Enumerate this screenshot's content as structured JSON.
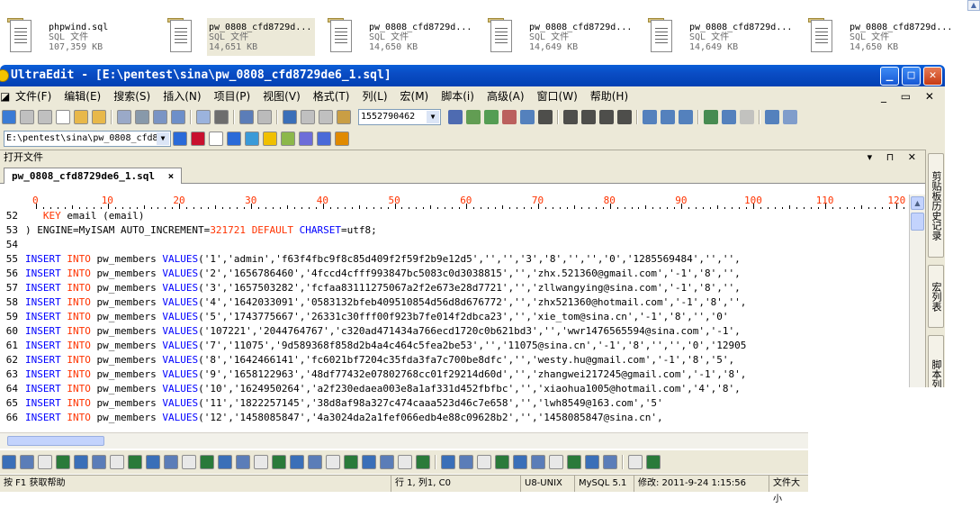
{
  "explorer": {
    "files": [
      {
        "name": "phpwind.sql",
        "type": "SQL 文件",
        "size": "107,359 KB",
        "selected": false
      },
      {
        "name": "pw_0808_cfd8729d...",
        "type": "SQL 文件",
        "size": "14,651 KB",
        "selected": true
      },
      {
        "name": "pw_0808_cfd8729d...",
        "type": "SQL 文件",
        "size": "14,650 KB",
        "selected": false
      },
      {
        "name": "pw_0808_cfd8729d...",
        "type": "SQL 文件",
        "size": "14,649 KB",
        "selected": false
      },
      {
        "name": "pw_0808_cfd8729d...",
        "type": "SQL 文件",
        "size": "14,649 KB",
        "selected": false
      },
      {
        "name": "pw_0808_cfd8729d...",
        "type": "SQL 文件",
        "size": "14,650 KB",
        "selected": false
      }
    ]
  },
  "window": {
    "title": "UltraEdit - [E:\\pentest\\sina\\pw_0808_cfd8729de6_1.sql]"
  },
  "menu": [
    "文件(F)",
    "编辑(E)",
    "搜索(S)",
    "插入(N)",
    "项目(P)",
    "视图(V)",
    "格式(T)",
    "列(L)",
    "宏(M)",
    "脚本(i)",
    "高级(A)",
    "窗口(W)",
    "帮助(H)"
  ],
  "toolbar": {
    "search_value": "1552790462",
    "path_value": "E:\\pentest\\sina\\pw_0808_cfd872"
  },
  "openfiles": {
    "label": "打开文件"
  },
  "tab": {
    "label": "pw_0808_cfd8729de6_1.sql",
    "close": "×"
  },
  "ruler": [
    "0",
    "10",
    "20",
    "30",
    "40",
    "50",
    "60",
    "70",
    "80",
    "90",
    "100",
    "110",
    "120"
  ],
  "editor": {
    "lines": [
      {
        "n": "52",
        "parts": [
          [
            "sp",
            "   "
          ],
          [
            "kw1",
            "KEY"
          ],
          [
            "str",
            " email (email)"
          ]
        ]
      },
      {
        "n": "53",
        "parts": [
          [
            "str",
            ") ENGINE=MyISAM AUTO_INCREMENT="
          ],
          [
            "kw1",
            "321721"
          ],
          [
            "str",
            " "
          ],
          [
            "kw1",
            "DEFAULT"
          ],
          [
            "str",
            " "
          ],
          [
            "kw2",
            "CHARSET"
          ],
          [
            "str",
            "=utf8;"
          ]
        ]
      },
      {
        "n": "54",
        "parts": []
      },
      {
        "n": "55",
        "parts": [
          [
            "kw2",
            "INSERT"
          ],
          [
            "str",
            " "
          ],
          [
            "kw1",
            "INTO"
          ],
          [
            "str",
            " pw_members "
          ],
          [
            "kw2",
            "VALUES"
          ],
          [
            "str",
            "('1','admin','f63f4fbc9f8c85d409f2f59f2b9e12d5','','','3','8','','','0','1285569484','','',"
          ]
        ]
      },
      {
        "n": "56",
        "parts": [
          [
            "kw2",
            "INSERT"
          ],
          [
            "str",
            " "
          ],
          [
            "kw1",
            "INTO"
          ],
          [
            "str",
            " pw_members "
          ],
          [
            "kw2",
            "VALUES"
          ],
          [
            "str",
            "('2','1656786460','4fccd4cfff993847bc5083c0d3038815','','zhx.521360@gmail.com','-1','8','',"
          ]
        ]
      },
      {
        "n": "57",
        "parts": [
          [
            "kw2",
            "INSERT"
          ],
          [
            "str",
            " "
          ],
          [
            "kw1",
            "INTO"
          ],
          [
            "str",
            " pw_members "
          ],
          [
            "kw2",
            "VALUES"
          ],
          [
            "str",
            "('3','1657503282','fcfaa83111275067a2f2e673e28d7721','','zllwangying@sina.com','-1','8','',"
          ]
        ]
      },
      {
        "n": "58",
        "parts": [
          [
            "kw2",
            "INSERT"
          ],
          [
            "str",
            " "
          ],
          [
            "kw1",
            "INTO"
          ],
          [
            "str",
            " pw_members "
          ],
          [
            "kw2",
            "VALUES"
          ],
          [
            "str",
            "('4','1642033091','0583132bfeb409510854d56d8d676772','','zhx521360@hotmail.com','-1','8','',"
          ]
        ]
      },
      {
        "n": "59",
        "parts": [
          [
            "kw2",
            "INSERT"
          ],
          [
            "str",
            " "
          ],
          [
            "kw1",
            "INTO"
          ],
          [
            "str",
            " pw_members "
          ],
          [
            "kw2",
            "VALUES"
          ],
          [
            "str",
            "('5','1743775667','26331c30fff00f923b7fe014f2dbca23','','xie_tom@sina.cn','-1','8','','0'"
          ]
        ]
      },
      {
        "n": "60",
        "parts": [
          [
            "kw2",
            "INSERT"
          ],
          [
            "str",
            " "
          ],
          [
            "kw1",
            "INTO"
          ],
          [
            "str",
            " pw_members "
          ],
          [
            "kw2",
            "VALUES"
          ],
          [
            "str",
            "('107221','2044764767','c320ad471434a766ecd1720c0b621bd3','','wwr1476565594@sina.com','-1',"
          ]
        ]
      },
      {
        "n": "61",
        "parts": [
          [
            "kw2",
            "INSERT"
          ],
          [
            "str",
            " "
          ],
          [
            "kw1",
            "INTO"
          ],
          [
            "str",
            " pw_members "
          ],
          [
            "kw2",
            "VALUES"
          ],
          [
            "str",
            "('7','11075','9d589368f858d2b4a4c464c5fea2be53','','11075@sina.cn','-1','8','','','0','12905"
          ]
        ]
      },
      {
        "n": "62",
        "parts": [
          [
            "kw2",
            "INSERT"
          ],
          [
            "str",
            " "
          ],
          [
            "kw1",
            "INTO"
          ],
          [
            "str",
            " pw_members "
          ],
          [
            "kw2",
            "VALUES"
          ],
          [
            "str",
            "('8','1642466141','fc6021bf7204c35fda3fa7c700be8dfc','','westy.hu@gmail.com','-1','8','5',"
          ]
        ]
      },
      {
        "n": "63",
        "parts": [
          [
            "kw2",
            "INSERT"
          ],
          [
            "str",
            " "
          ],
          [
            "kw1",
            "INTO"
          ],
          [
            "str",
            " pw_members "
          ],
          [
            "kw2",
            "VALUES"
          ],
          [
            "str",
            "('9','1658122963','48df77432e07802768cc01f29214d60d','','zhangwei217245@gmail.com','-1','8',"
          ]
        ]
      },
      {
        "n": "64",
        "parts": [
          [
            "kw2",
            "INSERT"
          ],
          [
            "str",
            " "
          ],
          [
            "kw1",
            "INTO"
          ],
          [
            "str",
            " pw_members "
          ],
          [
            "kw2",
            "VALUES"
          ],
          [
            "str",
            "('10','1624950264','a2f230edaea003e8a1af331d452fbfbc','','xiaohua1005@hotmail.com','4','8',"
          ]
        ]
      },
      {
        "n": "65",
        "parts": [
          [
            "kw2",
            "INSERT"
          ],
          [
            "str",
            " "
          ],
          [
            "kw1",
            "INTO"
          ],
          [
            "str",
            " pw_members "
          ],
          [
            "kw2",
            "VALUES"
          ],
          [
            "str",
            "('11','1822257145','38d8af98a327c474caaa523d46c7e658','','lwh8549@163.com','5'"
          ]
        ]
      },
      {
        "n": "66",
        "parts": [
          [
            "kw2",
            "INSERT"
          ],
          [
            "str",
            " "
          ],
          [
            "kw1",
            "INTO"
          ],
          [
            "str",
            " pw_members "
          ],
          [
            "kw2",
            "VALUES"
          ],
          [
            "str",
            "('12','1458085847','4a3024da2a1fef066edb4e88c09628b2','','1458085847@sina.cn',"
          ]
        ]
      }
    ]
  },
  "sidepanel": {
    "tabs": [
      "剪贴板历史记录",
      "宏列表",
      "脚本列表"
    ]
  },
  "status": {
    "help": "按 F1 获取帮助",
    "position": "行 1, 列1, C0",
    "encoding": "U8-UNIX",
    "syntax": "MySQL 5.1",
    "modified": "修改: 2011-9-24 1:15:56",
    "filesize": "文件大小"
  }
}
